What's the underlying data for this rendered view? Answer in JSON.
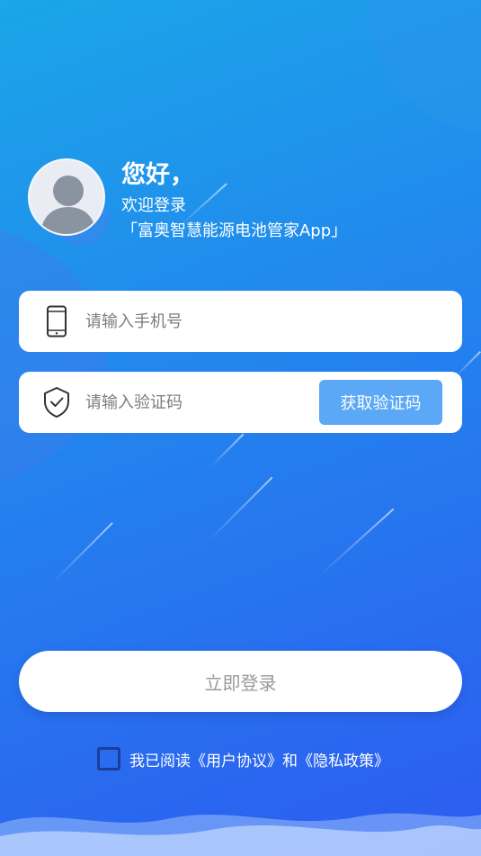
{
  "header": {
    "greeting": "您好，",
    "welcome": "欢迎登录",
    "app_name": "「富奥智慧能源电池管家App」"
  },
  "form": {
    "phone": {
      "placeholder": "请输入手机号",
      "value": "",
      "icon": "phone-icon"
    },
    "code": {
      "placeholder": "请输入验证码",
      "value": "",
      "icon": "shield-check-icon",
      "button_label": "获取验证码"
    }
  },
  "login": {
    "label": "立即登录"
  },
  "agreement": {
    "text": "我已阅读《用户协议》和《隐私政策》",
    "checked": false
  },
  "colors": {
    "bg_top": "#1aa6e8",
    "bg_bottom": "#2d5bf0",
    "code_button": "#5aa8f6",
    "checkbox_border": "#1a3e9a"
  }
}
